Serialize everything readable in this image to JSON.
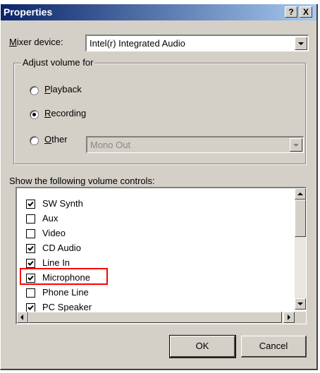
{
  "dialog": {
    "title": "Properties",
    "help_button": "?",
    "close_button": "X"
  },
  "mixer": {
    "label_accel": "M",
    "label_rest": "ixer device:",
    "value": "Intel(r) Integrated Audio"
  },
  "adjust_volume": {
    "legend": "Adjust volume for",
    "options": [
      {
        "accel": "P",
        "rest": "layback",
        "selected": false
      },
      {
        "accel": "R",
        "rest": "ecording",
        "selected": true
      },
      {
        "accel": "O",
        "rest": "ther",
        "selected": false
      }
    ],
    "other_device": "Mono Out"
  },
  "volume_controls": {
    "label": "Show the following volume controls:",
    "items": [
      {
        "label": "SW Synth",
        "checked": true
      },
      {
        "label": "Aux",
        "checked": false
      },
      {
        "label": "Video",
        "checked": false
      },
      {
        "label": "CD Audio",
        "checked": true
      },
      {
        "label": "Line In",
        "checked": true
      },
      {
        "label": "Microphone",
        "checked": true
      },
      {
        "label": "Phone Line",
        "checked": false
      },
      {
        "label": "PC Speaker",
        "checked": true
      }
    ]
  },
  "buttons": {
    "ok": "OK",
    "cancel": "Cancel"
  },
  "colors": {
    "titlebar_start": "#0a246a",
    "titlebar_end": "#a6caf0",
    "dialog_face": "#d4d0c8",
    "highlight_box": "#ff0000"
  }
}
